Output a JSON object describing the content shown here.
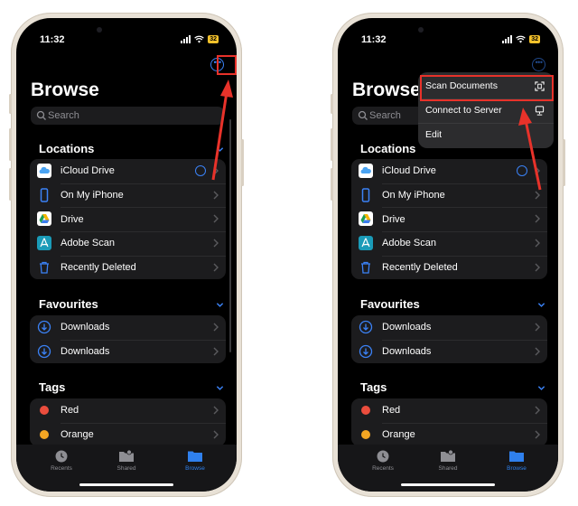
{
  "colors": {
    "accent": "#3b82f6",
    "highlight": "#e8322a",
    "battery": "#f5c22b",
    "red_tag": "#eb4d3d",
    "orange_tag": "#f4a623"
  },
  "status": {
    "time": "11:32",
    "battery": "32"
  },
  "page": {
    "title": "Browse"
  },
  "search": {
    "placeholder": "Search"
  },
  "locations": {
    "header": "Locations",
    "items": [
      {
        "label": "iCloud Drive",
        "icon": "icloud-icon"
      },
      {
        "label": "On My iPhone",
        "icon": "iphone-icon"
      },
      {
        "label": "Drive",
        "icon": "google-drive-icon"
      },
      {
        "label": "Adobe Scan",
        "icon": "adobe-scan-icon"
      },
      {
        "label": "Recently Deleted",
        "icon": "trash-icon"
      }
    ]
  },
  "favourites": {
    "header": "Favourites",
    "items": [
      {
        "label": "Downloads",
        "icon": "download-icon"
      },
      {
        "label": "Downloads",
        "icon": "download-icon"
      }
    ]
  },
  "tags": {
    "header": "Tags",
    "items": [
      {
        "label": "Red"
      },
      {
        "label": "Orange"
      }
    ]
  },
  "tabbar": {
    "recents": "Recents",
    "shared": "Shared",
    "browse": "Browse"
  },
  "menu": {
    "scan": "Scan Documents",
    "connect": "Connect to Server",
    "edit": "Edit"
  }
}
